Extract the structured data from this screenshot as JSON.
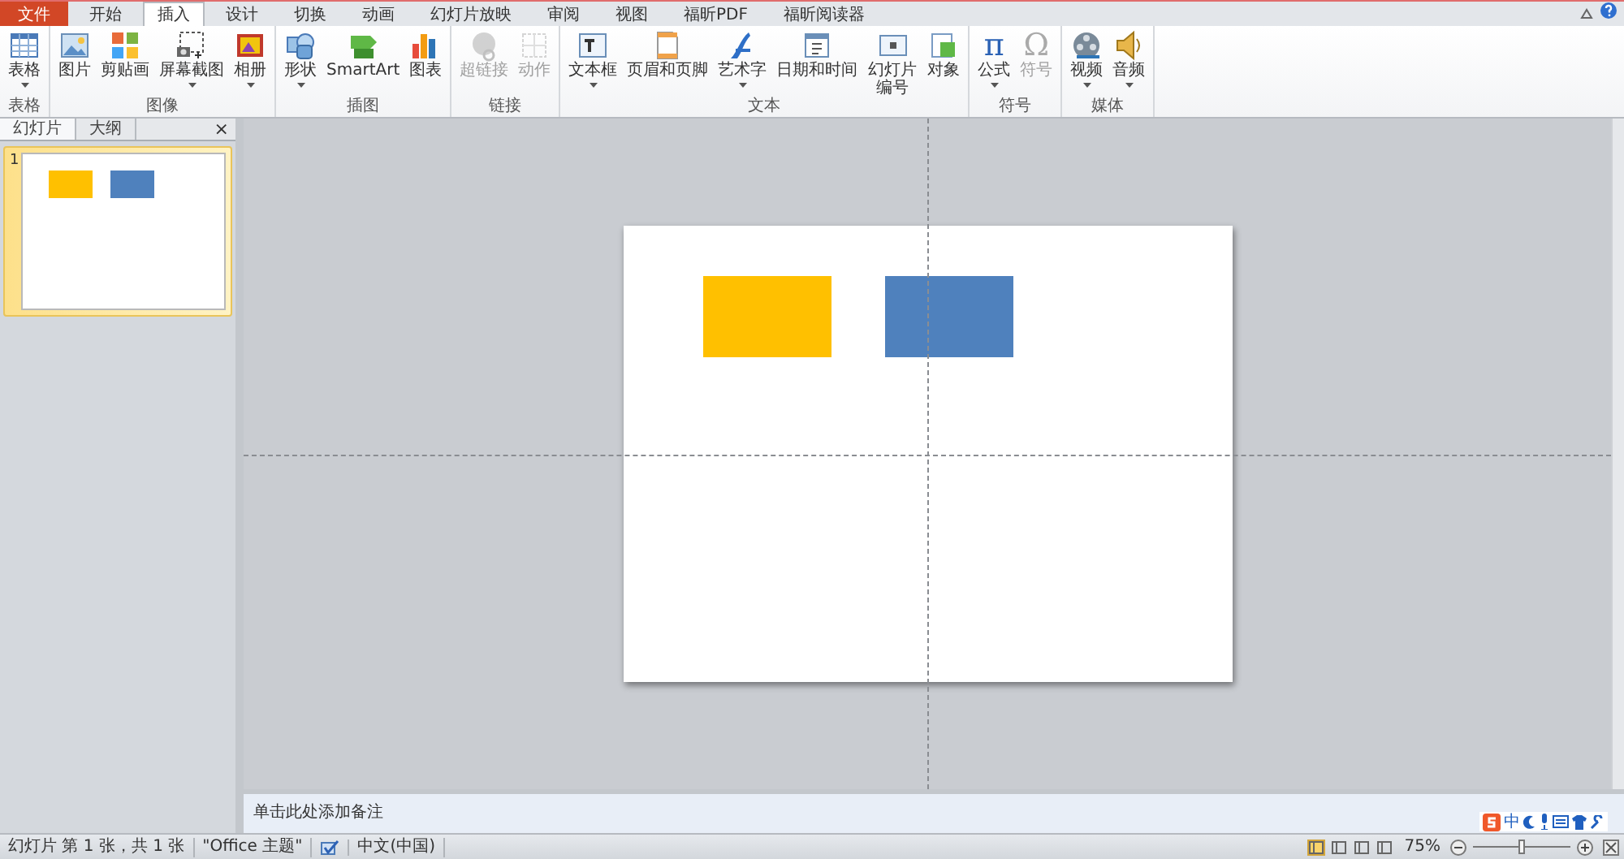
{
  "tabs": [
    {
      "label": "文件",
      "kind": "file",
      "selected": false
    },
    {
      "label": "开始",
      "kind": "tab",
      "selected": false
    },
    {
      "label": "插入",
      "kind": "tab",
      "selected": true
    },
    {
      "label": "设计",
      "kind": "tab",
      "selected": false
    },
    {
      "label": "切换",
      "kind": "tab",
      "selected": false
    },
    {
      "label": "动画",
      "kind": "tab",
      "selected": false
    },
    {
      "label": "幻灯片放映",
      "kind": "tab",
      "selected": false
    },
    {
      "label": "审阅",
      "kind": "tab",
      "selected": false
    },
    {
      "label": "视图",
      "kind": "tab",
      "selected": false
    },
    {
      "label": "福昕PDF",
      "kind": "tab",
      "selected": false
    },
    {
      "label": "福昕阅读器",
      "kind": "tab",
      "selected": false
    }
  ],
  "ribbon_groups": [
    {
      "label": "表格",
      "buttons": [
        {
          "label": "表格",
          "disabled": false,
          "dropdown": true
        }
      ]
    },
    {
      "label": "图像",
      "buttons": [
        {
          "label": "图片",
          "disabled": false,
          "dropdown": false
        },
        {
          "label": "剪贴画",
          "disabled": false,
          "dropdown": false
        },
        {
          "label": "屏幕截图",
          "disabled": false,
          "dropdown": true
        },
        {
          "label": "相册",
          "disabled": false,
          "dropdown": true
        }
      ]
    },
    {
      "label": "插图",
      "buttons": [
        {
          "label": "形状",
          "disabled": false,
          "dropdown": true
        },
        {
          "label": "SmartArt",
          "disabled": false,
          "dropdown": false
        },
        {
          "label": "图表",
          "disabled": false,
          "dropdown": false
        }
      ]
    },
    {
      "label": "链接",
      "buttons": [
        {
          "label": "超链接",
          "disabled": true,
          "dropdown": false
        },
        {
          "label": "动作",
          "disabled": true,
          "dropdown": false
        }
      ]
    },
    {
      "label": "文本",
      "buttons": [
        {
          "label": "文本框",
          "disabled": false,
          "dropdown": true
        },
        {
          "label": "页眉和页脚",
          "disabled": false,
          "dropdown": false
        },
        {
          "label": "艺术字",
          "disabled": false,
          "dropdown": true
        },
        {
          "label": "日期和时间",
          "disabled": false,
          "dropdown": false
        },
        {
          "label": "幻灯片编号",
          "disabled": false,
          "dropdown": false
        },
        {
          "label": "对象",
          "disabled": false,
          "dropdown": false
        }
      ]
    },
    {
      "label": "符号",
      "buttons": [
        {
          "label": "公式",
          "glyph": "π",
          "disabled": false,
          "dropdown": true
        },
        {
          "label": "符号",
          "glyph": "Ω",
          "disabled": true,
          "dropdown": false
        }
      ]
    },
    {
      "label": "媒体",
      "buttons": [
        {
          "label": "视频",
          "disabled": false,
          "dropdown": true
        },
        {
          "label": "音频",
          "disabled": false,
          "dropdown": true
        }
      ]
    }
  ],
  "slides_panel": {
    "tabs": [
      {
        "label": "幻灯片",
        "selected": true
      },
      {
        "label": "大纲",
        "selected": false
      }
    ],
    "close": "×",
    "thumbnails": [
      {
        "number": "1",
        "selected": true
      }
    ]
  },
  "slide": {
    "shapes": [
      {
        "color": "#ffc000"
      },
      {
        "color": "#4f81bd"
      }
    ]
  },
  "notes": {
    "prompt": "单击此处添加备注"
  },
  "ime_bar": {
    "mode": "中"
  },
  "status_bar": {
    "slide_info": "幻灯片 第 1 张，共 1 张",
    "theme": "\"Office 主题\"",
    "language": "中文(中国)",
    "zoom": "75%",
    "zoom_slider": {
      "level": 0.5
    },
    "views": [
      {
        "selected": true
      },
      {
        "selected": false
      },
      {
        "selected": false
      },
      {
        "selected": false
      }
    ]
  }
}
